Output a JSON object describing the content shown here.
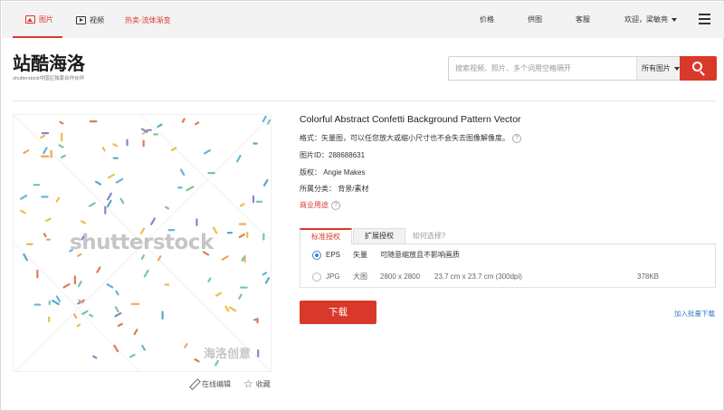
{
  "topbar": {
    "tabs": [
      {
        "label": "图片",
        "icon": "image-icon",
        "active": true
      },
      {
        "label": "视频",
        "icon": "video-icon",
        "active": false
      }
    ],
    "hot_label": "热卖-流体渐变",
    "nav": [
      "价格",
      "供图",
      "客服"
    ],
    "user_label": "欢迎，梁敏亮",
    "menu_icon": "hamburger-menu-icon"
  },
  "header": {
    "logo_main": "站酷海洛",
    "logo_sub": "shutterstock中国区独家合作伙伴",
    "search_placeholder": "搜索视频、照片、多个词用空格隔开",
    "search_filter": "所有图片",
    "search_icon": "search-icon"
  },
  "preview": {
    "watermark": "shutterstock",
    "watermark_cn": "海洛创意",
    "edit_label": "在线编辑",
    "fav_label": "收藏",
    "confetti_colors": [
      "#e8c04a",
      "#5aa8c8",
      "#e07a55",
      "#7bc4a2",
      "#8a86c8",
      "#f2a65a",
      "#67b5d8"
    ]
  },
  "details": {
    "title": "Colorful Abstract Confetti Background Pattern Vector",
    "format": "格式：矢量图，可以任您放大或缩小尺寸也不会失去图像解像度。",
    "image_id": "图片ID：288688631",
    "copyright": "版权：  Angie Makes",
    "category": "所属分类：  背景/素材",
    "commercial_use": "商业用途"
  },
  "license": {
    "tabs": [
      "标准授权",
      "扩展授权",
      "如何选择?"
    ],
    "options": [
      {
        "format": "EPS",
        "kind": "矢量",
        "desc": "可随意缩放且不影响画质",
        "selected": true
      },
      {
        "format": "JPG",
        "kind": "大图",
        "px": "2800 x 2800",
        "cm": "23.7 cm x 23.7 cm (300dpi)",
        "size": "378KB",
        "selected": false
      }
    ]
  },
  "actions": {
    "download": "下载",
    "bulk": "加入批量下载"
  },
  "colors": {
    "accent": "#d9392b",
    "link": "#3b78c9",
    "radio": "#3b86d8"
  }
}
